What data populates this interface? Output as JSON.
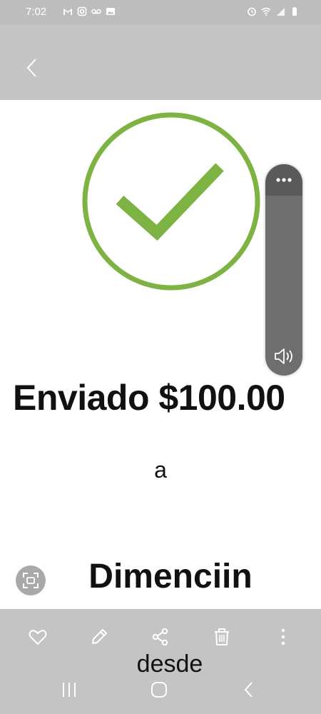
{
  "status_bar": {
    "time": "7:02",
    "left_icons": [
      "gmail-icon",
      "instagram-icon",
      "voicemail-icon",
      "gallery-icon"
    ],
    "right_icons": [
      "alarm-icon",
      "wifi-icon",
      "signal-icon",
      "battery-icon"
    ]
  },
  "header": {
    "back_icon": "chevron-left-icon"
  },
  "receipt": {
    "status_icon": "check-circle-icon",
    "accent_color": "#7cb342",
    "amount_text": "Enviado $100.00",
    "connector": "a",
    "recipient_name": "Dimenciin"
  },
  "volume_overlay": {
    "more_icon": "more-dots-icon",
    "volume_icon": "volume-icon"
  },
  "bottom_actions": {
    "icons": [
      "heart-icon",
      "edit-icon",
      "share-icon",
      "trash-icon",
      "more-vertical-icon"
    ],
    "caption": "desde"
  },
  "nav_bar": {
    "icons": [
      "recents-icon",
      "home-icon",
      "back-icon"
    ]
  }
}
